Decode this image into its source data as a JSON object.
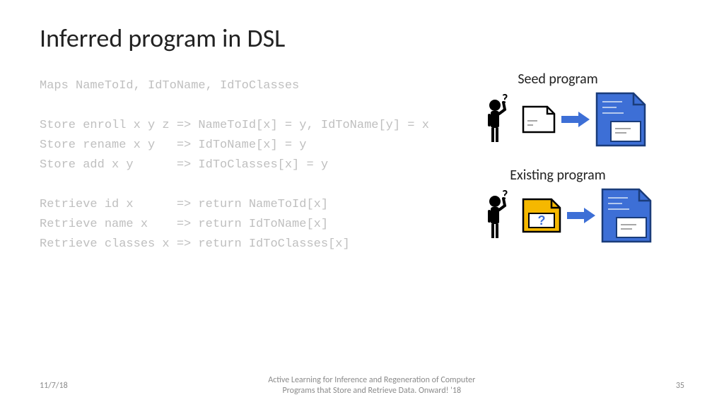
{
  "title": "Inferred program in DSL",
  "code": "Maps NameToId, IdToName, IdToClasses\n\nStore enroll x y z => NameToId[x] = y, IdToName[y] = x\nStore rename x y   => IdToName[x] = y\nStore add x y      => IdToClasses[x] = y\n\nRetrieve id x      => return NameToId[x]\nRetrieve name x    => return IdToName[x]\nRetrieve classes x => return IdToClasses[x]",
  "sections": {
    "seed": "Seed program",
    "existing": "Existing program"
  },
  "existing_icon_char": "?",
  "footer": {
    "date": "11/7/18",
    "center": "Active Learning for Inference and Regeneration of Computer\nPrograms that Store and Retrieve Data. Onward! '18",
    "page": "35"
  },
  "colors": {
    "blue": "#3d6fd6",
    "yellow": "#f5b800"
  }
}
